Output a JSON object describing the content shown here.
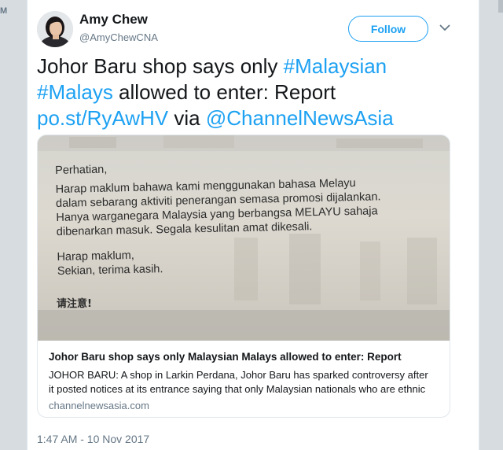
{
  "edge": {
    "left_mark": "M"
  },
  "tweet": {
    "author_name": "Amy Chew",
    "author_handle": "@AmyChewCNA",
    "follow_label": "Follow",
    "text_parts": {
      "p1": "Johor Baru shop says only ",
      "hashtag1": "#Malaysian",
      "hashtag2": "#Malays",
      "p2": " allowed to enter: Report  ",
      "link": "po.st/RyAwHV",
      "p3": " via ",
      "mention": "@ChannelNewsAsia"
    },
    "timestamp": "1:47 AM - 10 Nov 2017"
  },
  "card": {
    "image_text": {
      "line1": "Perhatian,",
      "line2": "Harap maklum bahawa kami menggunakan bahasa Melayu",
      "line3": "dalam sebarang aktiviti penerangan semasa promosi dijalankan.",
      "line4": "Hanya warganegara Malaysia yang berbangsa MELAYU sahaja",
      "line5": "dibenarkan masuk. Segala kesulitan amat dikesali.",
      "line6": "Harap maklum,",
      "line7": "Sekian, terima kasih.",
      "line8": "请注意!"
    },
    "title": "Johor Baru shop says only Malaysian Malays allowed to enter: Report",
    "description_line1": "JOHOR BARU: A shop in Larkin Perdana, Johor Baru has sparked controversy after",
    "description_line2": "it posted notices at its entrance saying that only Malaysian nationals who are ethnic",
    "domain": "channelnewsasia.com"
  },
  "colors": {
    "link_blue": "#1da1f2",
    "text": "#14171a",
    "muted": "#657786",
    "border": "#e1e8ed"
  },
  "icons": {
    "caret": "chevron-down-icon",
    "avatar": "avatar"
  }
}
